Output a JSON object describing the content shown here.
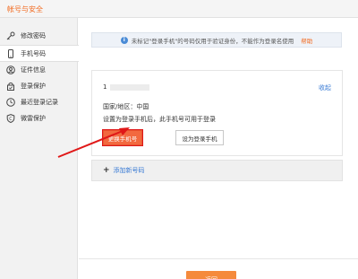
{
  "window": {
    "title": "帐号与安全"
  },
  "sidebar": {
    "items": [
      {
        "label": "修改密码",
        "icon": "key-icon"
      },
      {
        "label": "手机号码",
        "icon": "phone-icon",
        "active": true
      },
      {
        "label": "证件信息",
        "icon": "id-card-icon"
      },
      {
        "label": "登录保护",
        "icon": "lock-icon"
      },
      {
        "label": "最近登录记录",
        "icon": "clock-icon"
      },
      {
        "label": "微雷保护",
        "icon": "shield-icon"
      }
    ]
  },
  "notice": {
    "text": "未标记\"登录手机\"的号码仅用于验证身份，不能作为登录名使用",
    "help_label": "帮助"
  },
  "phone_card": {
    "phone_prefix": "1",
    "collapse_label": "收起",
    "region": "国家/地区：中国",
    "description": "设置为登录手机后，此手机号可用于登录",
    "change_button": "更换手机号",
    "set_login_button": "设为登录手机"
  },
  "add_number": {
    "plus": "+",
    "label": "添加新号码"
  },
  "footer": {
    "back_button": "返回"
  },
  "colors": {
    "accent": "#f26b21",
    "link": "#3a7bd5",
    "highlight": "#e01818"
  }
}
